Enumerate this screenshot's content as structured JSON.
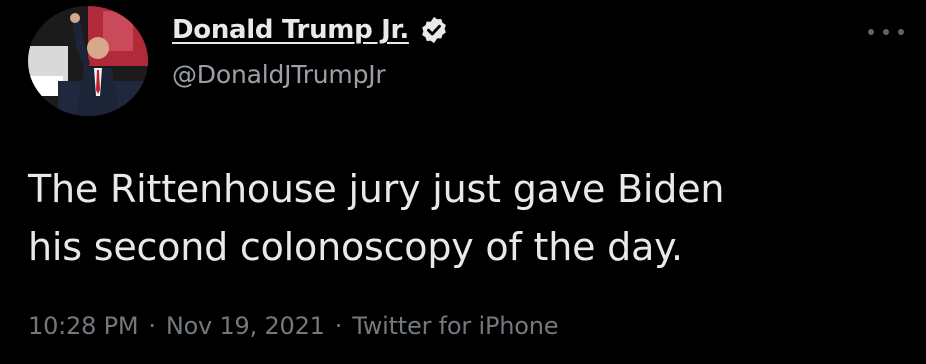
{
  "author": {
    "display_name": "Donald Trump Jr.",
    "handle": "@DonaldJTrumpJr",
    "verified": true
  },
  "tweet": {
    "text_lines": [
      "The Rittenhouse jury just gave Biden",
      "his second colonoscopy of the day."
    ]
  },
  "meta": {
    "time": "10:28 PM",
    "separator": "·",
    "date": "Nov 19, 2021",
    "source": "Twitter for iPhone"
  },
  "icons": {
    "verified": "verified-badge-icon",
    "more": "more-options-icon"
  },
  "colors": {
    "background": "#000000",
    "text": "#e7e9ea",
    "secondary": "#73787d"
  }
}
